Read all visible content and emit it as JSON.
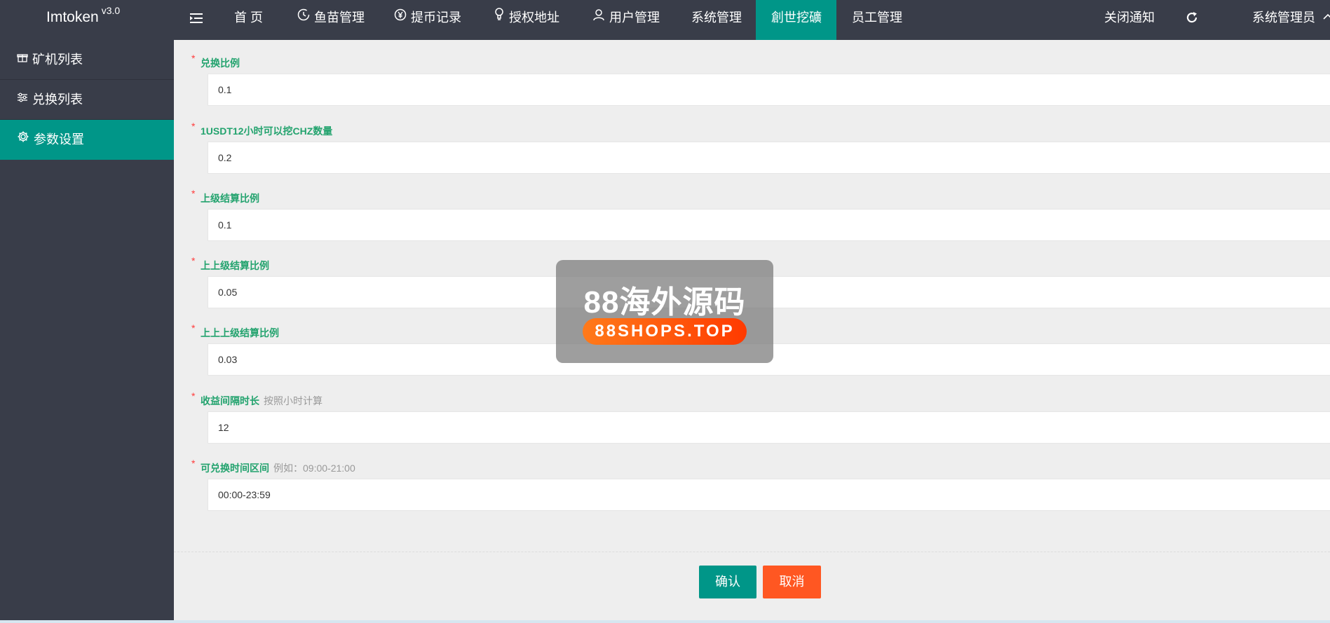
{
  "header": {
    "logo": "Imtoken",
    "version": "v3.0",
    "nav": [
      {
        "label": "首 页",
        "icon": "none"
      },
      {
        "label": "鱼苗管理",
        "icon": "clock-icon"
      },
      {
        "label": "提币记录",
        "icon": "yen-icon"
      },
      {
        "label": "授权地址",
        "icon": "bulb-icon"
      },
      {
        "label": "用户管理",
        "icon": "user-icon"
      },
      {
        "label": "系统管理",
        "icon": "none"
      },
      {
        "label": "創世挖礦",
        "icon": "none",
        "active": true
      },
      {
        "label": "员工管理",
        "icon": "none"
      }
    ],
    "close_notice": "关闭通知",
    "user": "系统管理员"
  },
  "sidebar": {
    "items": [
      {
        "label": "矿机列表",
        "icon": "gift-icon"
      },
      {
        "label": "兑换列表",
        "icon": "sliders-icon"
      },
      {
        "label": "参数设置",
        "icon": "gear-icon",
        "active": true
      }
    ]
  },
  "form": {
    "fields": [
      {
        "label": "兑换比例",
        "hint": "",
        "value": "0.1"
      },
      {
        "label": "1USDT12小时可以挖CHZ数量",
        "hint": "",
        "value": "0.2"
      },
      {
        "label": "上级结算比例",
        "hint": "",
        "value": "0.1"
      },
      {
        "label": "上上级结算比例",
        "hint": "",
        "value": "0.05"
      },
      {
        "label": "上上上级结算比例",
        "hint": "",
        "value": "0.03"
      },
      {
        "label": "收益间隔时长",
        "hint": "按照小时计算",
        "value": "12"
      },
      {
        "label": "可兑换时间区间",
        "hint": "例如：09:00-21:00",
        "value": "00:00-23:59"
      }
    ],
    "required_mark": "*",
    "confirm_label": "确认",
    "cancel_label": "取消"
  },
  "watermark": {
    "title": "88海外源码",
    "url": "88SHOPS.TOP"
  },
  "colors": {
    "header_bg": "#393d49",
    "accent": "#009688",
    "cancel": "#ff5722",
    "label_green": "#23a36e"
  }
}
